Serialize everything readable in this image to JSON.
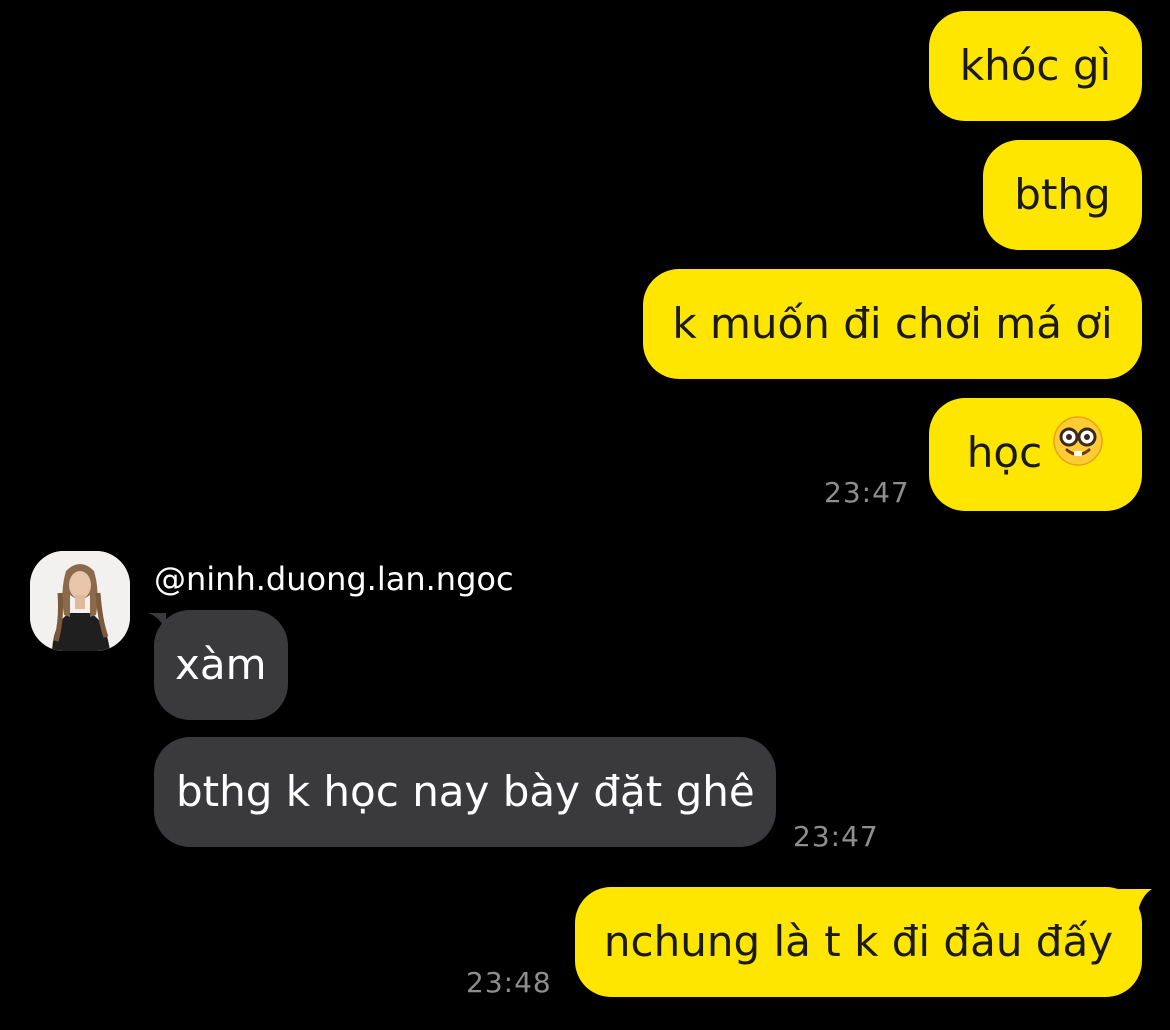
{
  "chat": {
    "messages_out_1": [
      {
        "text": "khóc gì"
      },
      {
        "text": "bthg"
      },
      {
        "text": "k muốn đi chơi má ơi"
      },
      {
        "text": "học",
        "emoji": "nerd-face-emoji"
      }
    ],
    "time_1": "23:47",
    "incoming": {
      "sender": "@ninh.duong.lan.ngoc",
      "avatar": "profile-photo",
      "messages": [
        {
          "text": "xàm"
        },
        {
          "text": "bthg k học nay bày đặt ghê"
        }
      ],
      "time": "23:47"
    },
    "messages_out_2": [
      {
        "text": "nchung là t k đi đâu đấy"
      }
    ],
    "time_2": "23:48"
  },
  "colors": {
    "background": "#000000",
    "outgoing_bubble": "#FFE600",
    "incoming_bubble": "#3a3a3c",
    "timestamp": "#8e8e8e"
  }
}
